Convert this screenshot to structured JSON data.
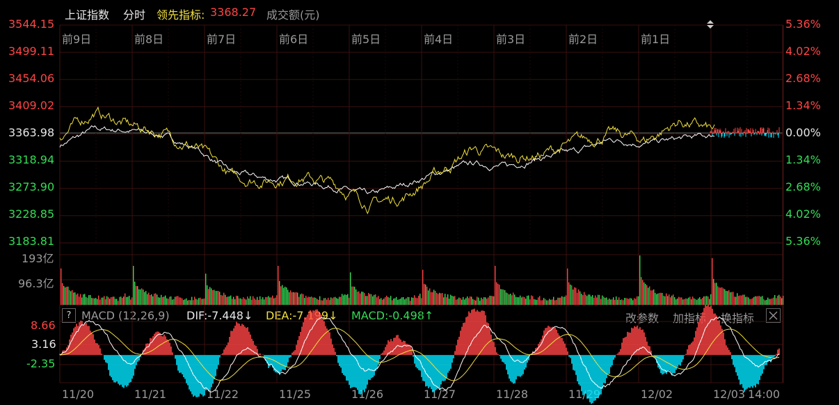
{
  "header": {
    "index_name": "上证指数",
    "mode": "分时",
    "leading_label": "领先指标:",
    "leading_value": "3368.27",
    "volume_label": "成交额(元)"
  },
  "price_axis": {
    "left": [
      "3544.15",
      "3499.11",
      "3454.06",
      "3409.02",
      "3363.98",
      "3318.94",
      "3273.90",
      "3228.85",
      "3183.81"
    ],
    "right": [
      "5.36%",
      "4.02%",
      "2.68%",
      "1.34%",
      "0.00%",
      "1.34%",
      "2.68%",
      "4.02%",
      "5.36%"
    ]
  },
  "day_labels": [
    "前9日",
    "前8日",
    "前7日",
    "前6日",
    "前5日",
    "前4日",
    "前3日",
    "前2日",
    "前1日"
  ],
  "volume_axis": [
    "193亿",
    "96.3亿"
  ],
  "macd": {
    "help": "?",
    "name": "MACD (12,26,9)",
    "dif": "DIF:-7.448↓",
    "dea": "DEA:-7.199↓",
    "macd": "MACD:-0.498↑",
    "axis": [
      "8.66",
      "3.16",
      "-2.35"
    ],
    "actions": [
      "改参数",
      "加指标",
      "换指标"
    ]
  },
  "x_labels": [
    "11/20",
    "11/21",
    "11/22",
    "11/25",
    "11/26",
    "11/27",
    "11/28",
    "11/29",
    "12/02",
    "12/03",
    "14:00"
  ],
  "colors": {
    "up": "#ff4444",
    "down": "#33dd55",
    "white_line": "#ffffff",
    "yellow_line": "#f0e040",
    "cyan": "#00e5ff",
    "grid": "#3a1010"
  },
  "chart_data": [
    {
      "type": "line",
      "title": "上证指数 分时",
      "ylim": [
        3183.81,
        3544.15
      ],
      "base": 3363.98,
      "x": [
        "11/20",
        "11/21",
        "11/22",
        "11/25",
        "11/26",
        "11/27",
        "11/28",
        "11/29",
        "12/02",
        "12/03"
      ],
      "series": [
        {
          "name": "上证指数",
          "values": [
            3345,
            3372,
            3370,
            3362,
            3338,
            3300,
            3290,
            3285,
            3276,
            3262,
            3280,
            3300,
            3315,
            3310,
            3325,
            3335,
            3355,
            3348,
            3356,
            3362
          ]
        },
        {
          "name": "领先指标",
          "values": [
            3360,
            3400,
            3378,
            3366,
            3340,
            3292,
            3287,
            3295,
            3280,
            3248,
            3260,
            3300,
            3340,
            3325,
            3330,
            3350,
            3365,
            3354,
            3385,
            3368.27
          ]
        }
      ]
    },
    {
      "type": "bar",
      "title": "成交额(元)",
      "ylim": [
        0,
        193
      ],
      "unit": "亿",
      "day_peaks": [
        140,
        150,
        120,
        150,
        125,
        135,
        150,
        140,
        190,
        180
      ]
    },
    {
      "type": "line",
      "title": "MACD (12,26,9)",
      "ylim": [
        -7.9,
        10.0
      ],
      "series": [
        {
          "name": "DIF",
          "last": -7.448
        },
        {
          "name": "DEA",
          "last": -7.199
        },
        {
          "name": "MACD",
          "last": -0.498
        }
      ]
    }
  ]
}
